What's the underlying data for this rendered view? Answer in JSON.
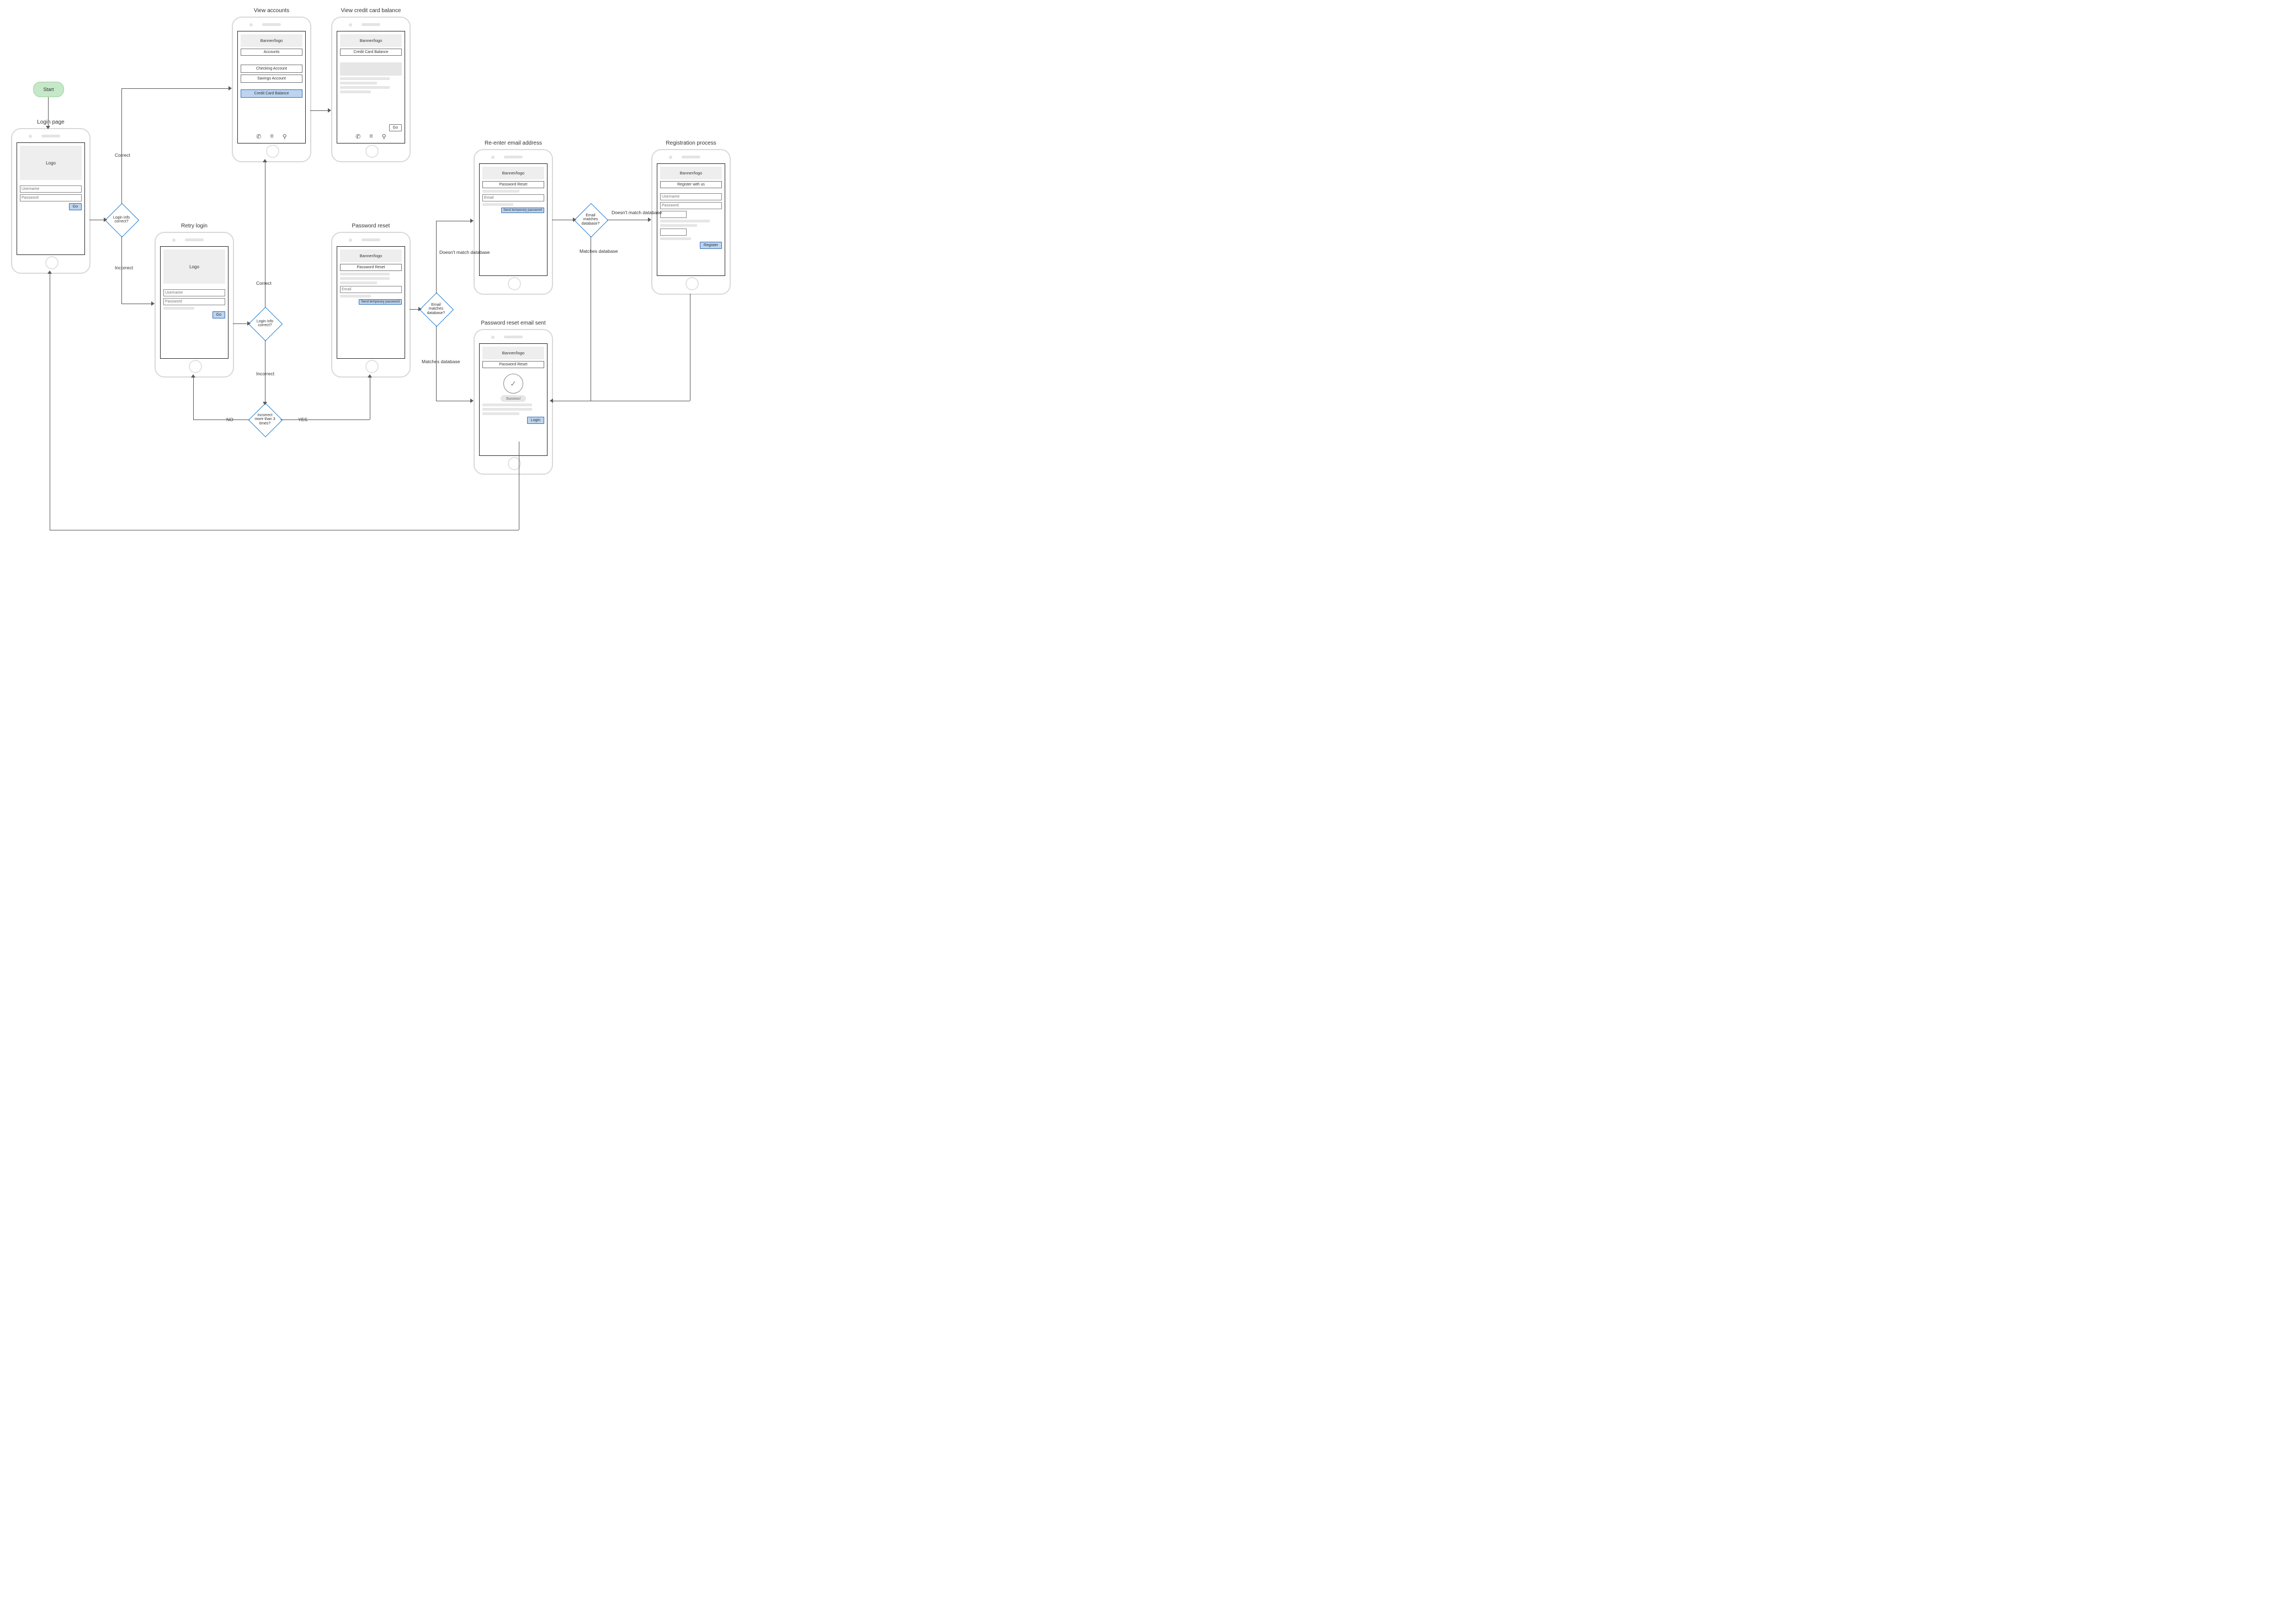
{
  "start": "Start",
  "phones": {
    "login": {
      "title": "Login page",
      "logo": "Logo",
      "user": "Username",
      "pass": "Password",
      "go": "Go"
    },
    "accounts": {
      "title": "View accounts",
      "banner": "Banner/logo",
      "sub": "Accounts",
      "r1": "Checking Account",
      "r2": "Savings Account",
      "r3": "Credit Card Balance"
    },
    "cc": {
      "title": "View credit card balance",
      "banner": "Banner/logo",
      "sub": "Credit Card Balance",
      "go": "Go"
    },
    "retry": {
      "title": "Retry login",
      "logo": "Logo",
      "user": "Username",
      "pass": "Password",
      "go": "Go"
    },
    "reset1": {
      "title": "Password reset",
      "banner": "Banner/logo",
      "sub": "Password Reset",
      "email": "Email",
      "send": "Send temporary password"
    },
    "reenter": {
      "title": "Re-enter email address",
      "banner": "Banner/logo",
      "sub": "Password Reset",
      "email": "Email",
      "send": "Send temporary password"
    },
    "sent": {
      "title": "Password reset email sent",
      "banner": "Banner/logo",
      "sub": "Password Reset",
      "ok": "Success!",
      "login": "Login"
    },
    "register": {
      "title": "Registration process",
      "banner": "Banner/logo",
      "sub": "Register with us",
      "user": "Username",
      "pass": "Password",
      "btn": "Register"
    }
  },
  "decisions": {
    "d1": "Login info correct?",
    "d2": "Login info correct?",
    "d3": "Incorrect more than 3 times?",
    "d4": "Email matches database?",
    "d5": "Email matches database?"
  },
  "labels": {
    "correct": "Correct",
    "incorrect": "Incorrect",
    "correct2": "Correct",
    "incorrect2": "Incorrect",
    "no": "NO",
    "yes": "YES",
    "noMatch1": "Doesn't match database",
    "match1": "Matches database",
    "noMatch2": "Doesn't match database",
    "match2": "Matches database"
  }
}
